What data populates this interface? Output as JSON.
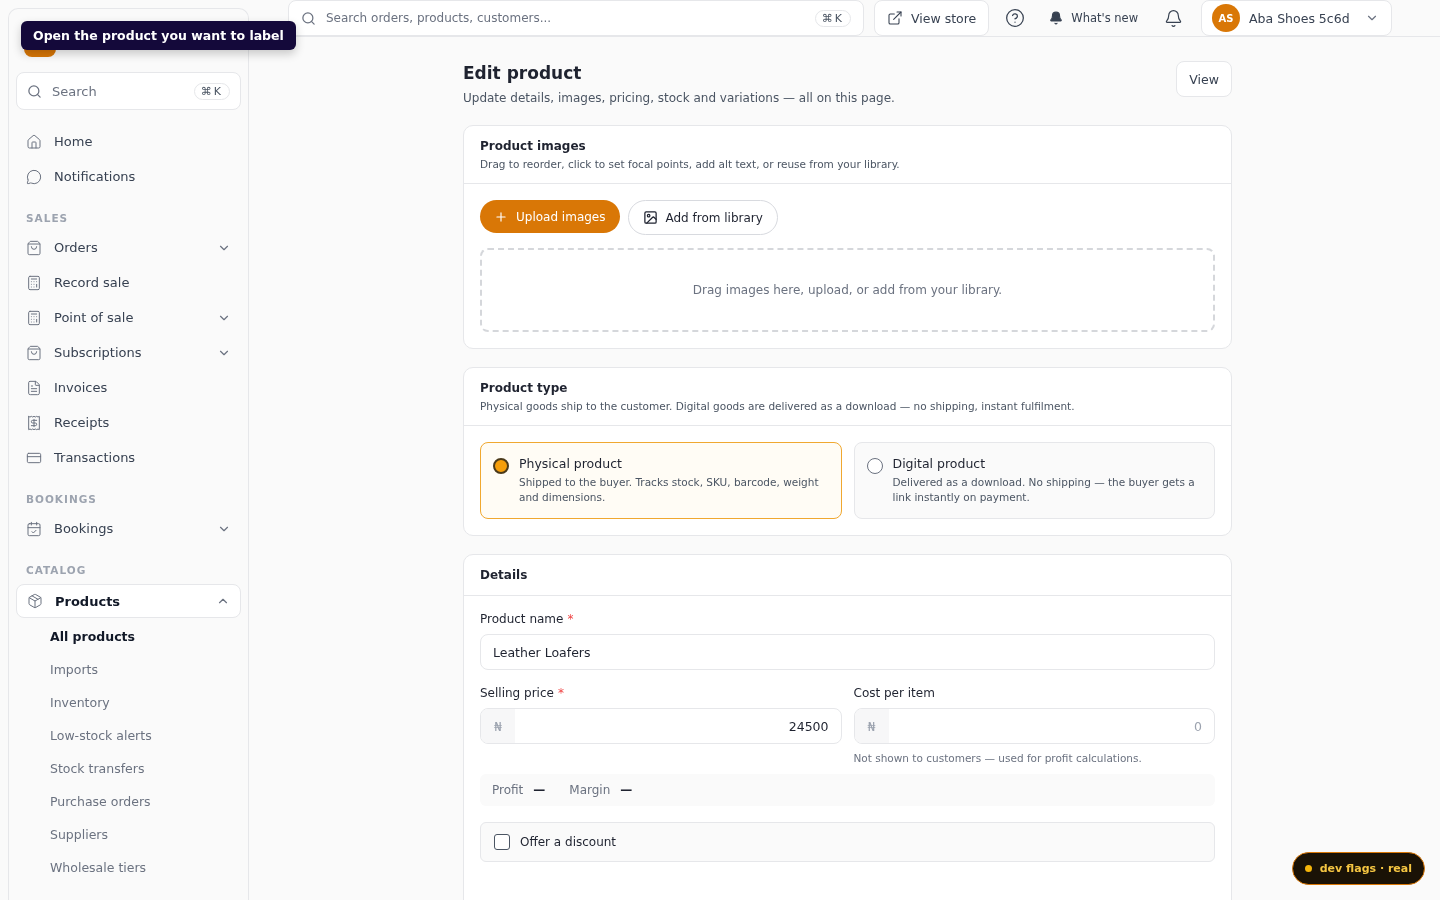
{
  "tooltip": "Open the product you want to label",
  "sidebar": {
    "search": {
      "placeholder": "Search",
      "shortcut": "⌘K"
    },
    "items": [
      {
        "label": "Home",
        "selected": false
      },
      {
        "label": "Notifications",
        "selected": false
      }
    ],
    "sections": [
      {
        "title": "SALES",
        "items": [
          {
            "label": "Orders",
            "expanded": false,
            "selected": false
          },
          {
            "label": "Record sale",
            "selected": false
          },
          {
            "label": "Point of sale",
            "expanded": false,
            "selected": false
          },
          {
            "label": "Subscriptions",
            "expanded": false,
            "selected": false
          },
          {
            "label": "Invoices",
            "selected": false
          },
          {
            "label": "Receipts",
            "selected": false
          },
          {
            "label": "Transactions",
            "selected": false
          }
        ]
      },
      {
        "title": "BOOKINGS",
        "items": [
          {
            "label": "Bookings",
            "expanded": false,
            "selected": false
          }
        ]
      },
      {
        "title": "CATALOG",
        "items": [
          {
            "label": "Products",
            "expanded": true,
            "selected": true,
            "children": [
              {
                "label": "All products",
                "selected": true
              },
              {
                "label": "Imports",
                "selected": false
              },
              {
                "label": "Inventory",
                "selected": false
              },
              {
                "label": "Low-stock alerts",
                "selected": false
              },
              {
                "label": "Stock transfers",
                "selected": false
              },
              {
                "label": "Purchase orders",
                "selected": false
              },
              {
                "label": "Suppliers",
                "selected": false
              },
              {
                "label": "Wholesale tiers",
                "selected": false
              }
            ]
          }
        ]
      }
    ]
  },
  "topbar": {
    "search": {
      "placeholder": "Search orders, products, customers...",
      "shortcut": "⌘K"
    },
    "view_store": "View store",
    "whats_new": "What's new",
    "account": {
      "initials": "AS",
      "name": "Aba Shoes 5c6d"
    }
  },
  "page": {
    "title": "Edit product",
    "subtitle": "Update details, images, pricing, stock and variations — all on this page.",
    "view_button": "View"
  },
  "images_card": {
    "title": "Product images",
    "subtitle": "Drag to reorder, click to set focal points, add alt text, or reuse from your library.",
    "upload_button": "Upload images",
    "library_button": "Add from library",
    "dropzone": "Drag images here, upload, or add from your library."
  },
  "type_card": {
    "title": "Product type",
    "subtitle": "Physical goods ship to the customer. Digital goods are delivered as a download — no shipping, instant fulfilment.",
    "options": [
      {
        "title": "Physical product",
        "description": "Shipped to the buyer. Tracks stock, SKU, barcode, weight and dimensions.",
        "selected": true
      },
      {
        "title": "Digital product",
        "description": "Delivered as a download. No shipping — the buyer gets a link instantly on payment.",
        "selected": false
      }
    ]
  },
  "details_card": {
    "title": "Details",
    "product_name": {
      "label": "Product name",
      "required_mark": "*",
      "value": "Leather Loafers"
    },
    "selling_price": {
      "label": "Selling price",
      "required_mark": "*",
      "prefix": "₦",
      "value": "24500"
    },
    "cost_per_item": {
      "label": "Cost per item",
      "prefix": "₦",
      "placeholder": "0",
      "hint": "Not shown to customers — used for profit calculations."
    },
    "summary": [
      {
        "label": "Profit",
        "value": "—"
      },
      {
        "label": "Margin",
        "value": "—"
      }
    ],
    "discount": {
      "label": "Offer a discount",
      "checked": false
    }
  },
  "dev_badge": {
    "label": "dev flags · real",
    "color": "#f5b50a"
  }
}
